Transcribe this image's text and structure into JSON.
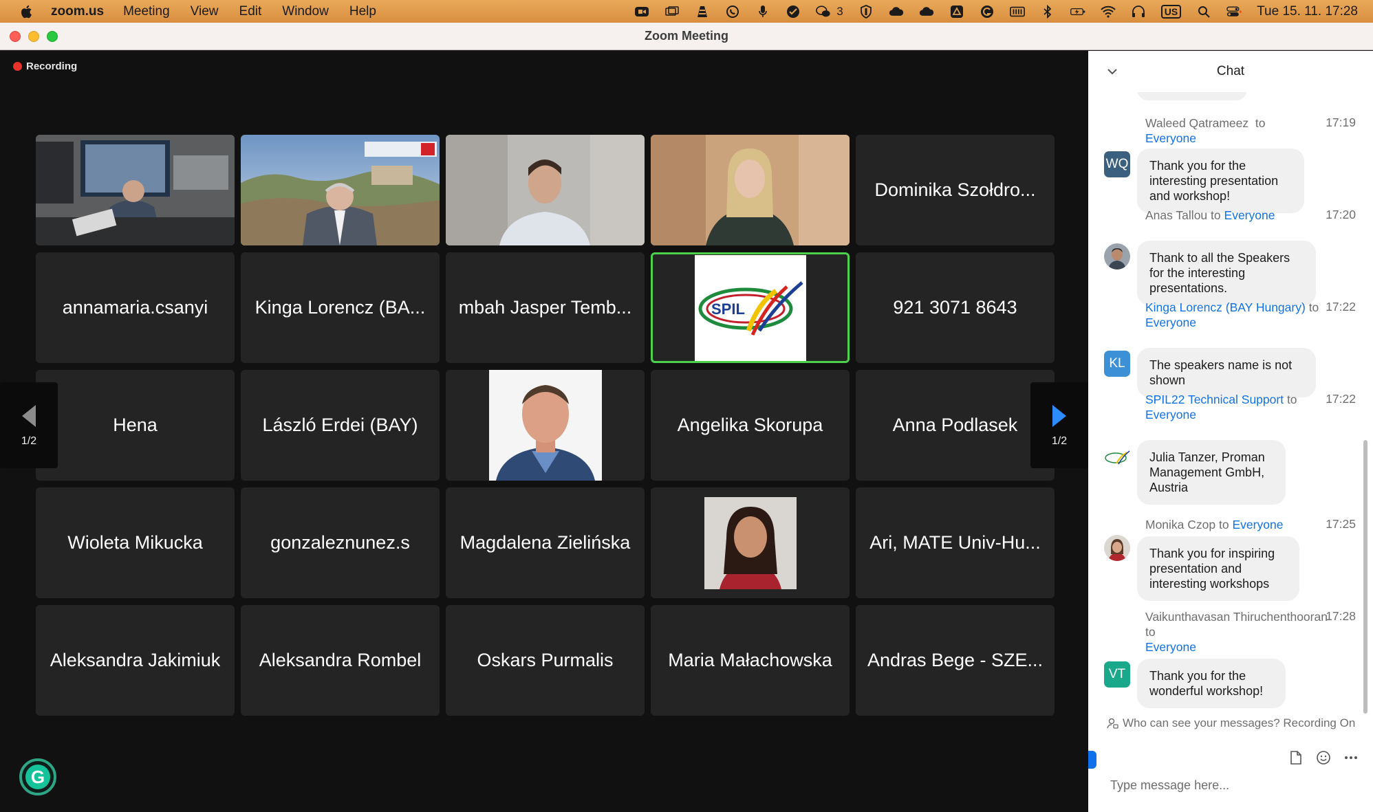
{
  "menubar": {
    "app_name": "zoom.us",
    "menus": [
      "Meeting",
      "View",
      "Edit",
      "Window",
      "Help"
    ],
    "status_icons": [
      "zoom-video-icon",
      "window-icon",
      "vlc-icon",
      "viber-icon",
      "microphone-icon",
      "checkbox-icon",
      "wechat-icon",
      "shield-icon",
      "cloud-icon",
      "cloud-icon",
      "drive-icon",
      "grammarly-icon",
      "memory-icon",
      "bluetooth-icon",
      "battery-charging-icon",
      "wifi-icon",
      "headphones-icon",
      "keyboard-layout-icon",
      "search-icon",
      "control-center-icon"
    ],
    "wechat_count": "3",
    "input_source": "US",
    "clock": "Tue 15. 11.  17:28"
  },
  "window": {
    "title": "Zoom Meeting"
  },
  "recording": {
    "label": "Recording",
    "color": "#e8322b"
  },
  "participants": [
    {
      "name": "",
      "kind": "video"
    },
    {
      "name": "",
      "kind": "video"
    },
    {
      "name": "",
      "kind": "video"
    },
    {
      "name": "",
      "kind": "video"
    },
    {
      "name": "Dominika Szołdro...",
      "kind": "name"
    },
    {
      "name": "annamaria.csanyi",
      "kind": "name"
    },
    {
      "name": "Kinga Lorencz (BA...",
      "kind": "name"
    },
    {
      "name": "mbah Jasper Temb...",
      "kind": "name"
    },
    {
      "name": "",
      "kind": "logo",
      "logo_text": "SPIL",
      "active": true
    },
    {
      "name": "921 3071 8643",
      "kind": "name"
    },
    {
      "name": "Hena",
      "kind": "name"
    },
    {
      "name": "László Erdei (BAY)",
      "kind": "name"
    },
    {
      "name": "",
      "kind": "photo"
    },
    {
      "name": "Angelika Skorupa",
      "kind": "name"
    },
    {
      "name": "Anna Podlasek",
      "kind": "name"
    },
    {
      "name": "Wioleta Mikucka",
      "kind": "name"
    },
    {
      "name": "gonzaleznunez.s",
      "kind": "name"
    },
    {
      "name": "Magdalena Zielińska",
      "kind": "name"
    },
    {
      "name": "",
      "kind": "photo"
    },
    {
      "name": "Ari, MATE Univ-Hu...",
      "kind": "name"
    },
    {
      "name": "Aleksandra Jakimiuk",
      "kind": "name"
    },
    {
      "name": "Aleksandra Rombel",
      "kind": "name"
    },
    {
      "name": "Oskars Purmalis",
      "kind": "name"
    },
    {
      "name": "Maria Małachowska",
      "kind": "name"
    },
    {
      "name": "Andras Bege - SZE...",
      "kind": "name"
    }
  ],
  "pagination": {
    "prev_page": "1/2",
    "next_page": "1/2",
    "accent": "#2d8cff"
  },
  "chat": {
    "title": "Chat",
    "messages": [
      {
        "sender": "Waleed Qatrameez",
        "to": "to",
        "audience": "Everyone",
        "time": "17:19",
        "avatar_initials": "WQ",
        "avatar_color": "#3b5f7f",
        "text": "Thank you for the interesting presentation and workshop!"
      },
      {
        "sender": "Anas Tallou",
        "to": "to",
        "audience": "Everyone",
        "time": "17:20",
        "avatar_initials": "",
        "avatar_color": "#7a6a5a",
        "text": "Thank to all the Speakers for the interesting presentations."
      },
      {
        "sender": "Kinga Lorencz (BAY Hungary)",
        "to": "to",
        "audience": "Everyone",
        "time": "17:22",
        "avatar_initials": "KL",
        "avatar_color": "#3c91d6",
        "text": "The speakers name is not shown"
      },
      {
        "sender": "SPIL22 Technical Support",
        "to": "to",
        "audience": "Everyone",
        "time": "17:22",
        "avatar_initials": "",
        "avatar_color": "#ffffff",
        "text": "Julia Tanzer, Proman Management GmbH, Austria"
      },
      {
        "sender": "Monika Czop",
        "to": "to",
        "audience": "Everyone",
        "time": "17:25",
        "avatar_initials": "",
        "avatar_color": "#8a7a70",
        "text": "Thank you for inspiring presentation and interesting workshops"
      },
      {
        "sender": "Vaikunthavasan Thiruchenthooran",
        "to": "to",
        "audience": "Everyone",
        "time": "17:28",
        "avatar_initials": "VT",
        "avatar_color": "#1aa88a",
        "text": "Thank you for the wonderful workshop!"
      }
    ],
    "privacy_note": "Who can see your messages? Recording On",
    "input_placeholder": "Type message here..."
  }
}
